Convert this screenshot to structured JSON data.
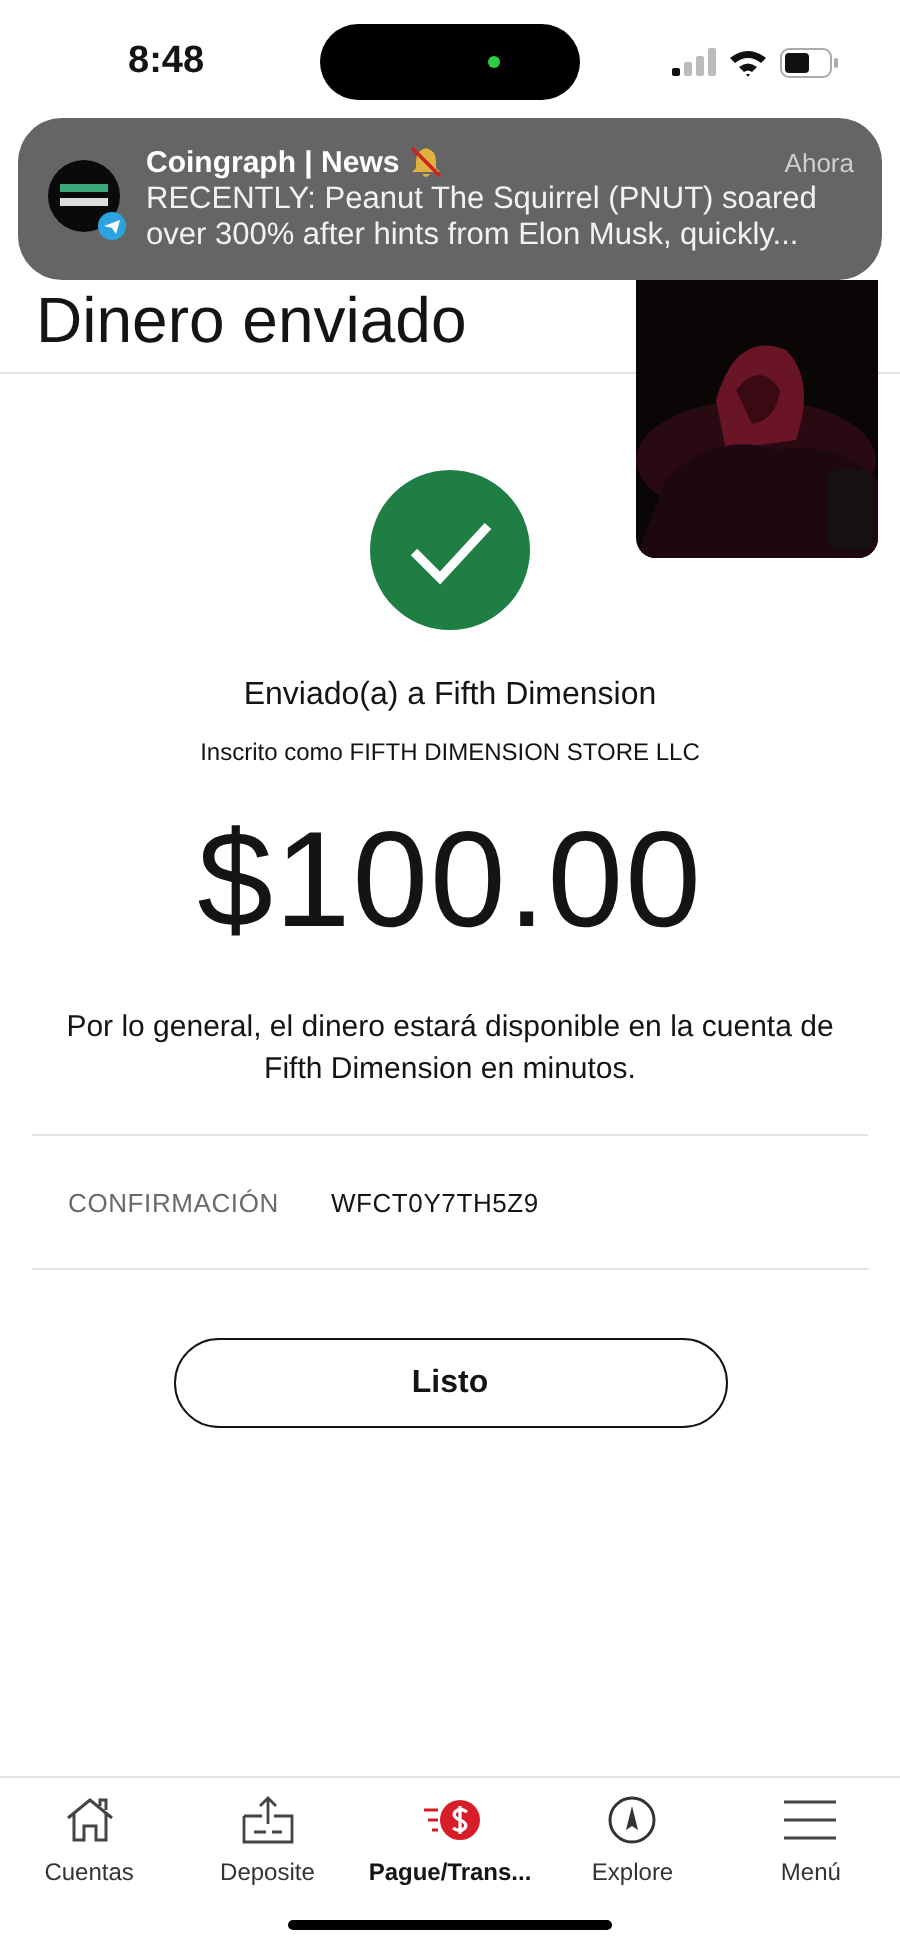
{
  "status_bar": {
    "time": "8:48"
  },
  "notification": {
    "app": "Coingraph | News",
    "time": "Ahora",
    "message": "RECENTLY: Peanut The Squirrel (PNUT) soared over 300% after hints from Elon Musk, quickly..."
  },
  "page": {
    "title": "Dinero enviado"
  },
  "receipt": {
    "recipient": "Enviado(a) a Fifth Dimension",
    "enrolled_as": "Inscrito como FIFTH DIMENSION STORE LLC",
    "amount": "$100.00",
    "note": "Por lo general, el dinero estará disponible en la cuenta de Fifth Dimension en minutos.",
    "confirmation_label": "CONFIRMACIÓN",
    "confirmation_code": "WFCT0Y7TH5Z9"
  },
  "buttons": [
    "Listo"
  ],
  "tab_bar": [
    {
      "kind": "home",
      "label": "Cuentas",
      "selected": false
    },
    {
      "kind": "deposit",
      "label": "Deposite",
      "selected": false
    },
    {
      "kind": "pay",
      "label": "Pague/Trans...",
      "selected": true
    },
    {
      "kind": "explore",
      "label": "Explore",
      "selected": false
    },
    {
      "kind": "menu",
      "label": "Menú",
      "selected": false
    }
  ]
}
